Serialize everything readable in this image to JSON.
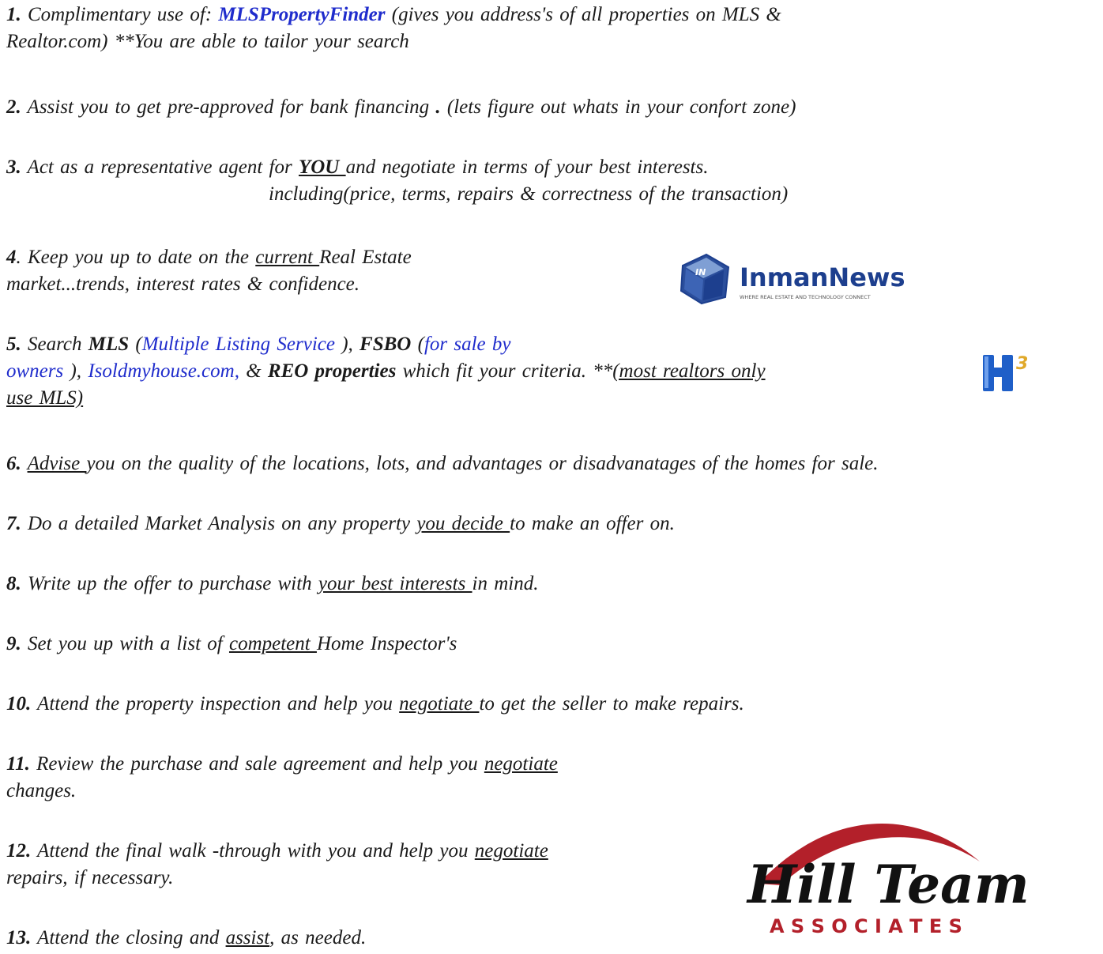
{
  "items": [
    {
      "num": "1.",
      "t1": " Complimentary  use of: ",
      "link": "MLSPropertyFinder",
      "t2": "   (gives you address's of all properties on MLS &",
      "t3": "Realtor.com)     **You are able to tailor your search"
    },
    {
      "num": "2.",
      "t1": " Assist you to get pre-approved for bank financing",
      "t2": " . ",
      "t3": " (lets figure out whats in your confort zone)"
    },
    {
      "num": "3.",
      "t1": " Act as a representative  agent for ",
      "u1": "YOU ",
      "t2": " and negotiate  in terms of your best interests.",
      "t3": "including(price,  terms,  repairs & correctness  of the transaction)"
    },
    {
      "num": "4",
      "t1": ". Keep you up to date on the ",
      "u1": "current ",
      "t2": " Real Estate",
      "t3": "market...trends,   interest rates & confidence."
    },
    {
      "num": "5.",
      "t1": " Search ",
      "b1": "MLS",
      "t2": " (",
      "l1": "Multiple Listing Service",
      "t3": " ), ",
      "b2": "FSBO",
      "t4": "  (",
      "l2": "for sale by",
      "l3": "owners",
      "t5": " ), ",
      "l4": "Isoldmyhouse.com,",
      "t6": "   & ",
      "b3": "REO properties",
      "t7": "  which fit your criteria. **",
      "u1": "(most  realtors only ",
      "u2": "use MLS)"
    },
    {
      "num": "6.",
      "t1": " ",
      "u1": "Advise ",
      "t2": " you on the quality of the locations, lots, and advantages  or disadvanatages  of the homes for sale."
    },
    {
      "num": "7.",
      "t1": " Do a detailed Market  Analysis on any property  ",
      "u1": "you decide ",
      "t2": " to make  an offer  on."
    },
    {
      "num": "8.",
      "t1": " Write up the offer to purchase with  ",
      "u1": "your best interests ",
      "t2": " in mind."
    },
    {
      "num": "9.",
      "t1": "  Set you up with a list of ",
      "u1": "competent ",
      "t2": "  Home Inspector's"
    },
    {
      "num": "10.",
      "t1": " Attend  the property  inspection  and help you ",
      "u1": "negotiate ",
      "t2": "  to get the seller to make  repairs."
    },
    {
      "num": "11.",
      "t1": " Review  the purchase  and sale agreement  and help you ",
      "u1": "negotiate ",
      "t2": "changes."
    },
    {
      "num": "12.",
      "t1": " Attend  the final walk -through  with you and help you ",
      "u1": "negotiate ",
      "t2": "repairs, if necessary."
    },
    {
      "num": "13.",
      "t1": " Attend  the closing and ",
      "u1": "assist",
      "t2": ",  as needed."
    }
  ],
  "logos": {
    "inman_text": "InmanNews",
    "inman_tagline": "WHERE REAL ESTATE AND TECHNOLOGY CONNECT",
    "inman_box_text": "IN",
    "h3_text": "H",
    "h3_sup": "3",
    "hill_script": "Hill Team",
    "hill_sub": "A S S O C I A T E S"
  },
  "colors": {
    "link_blue": "#1f2ccc",
    "inman_blue": "#1d3f8e",
    "hill_red": "#b3202a"
  }
}
